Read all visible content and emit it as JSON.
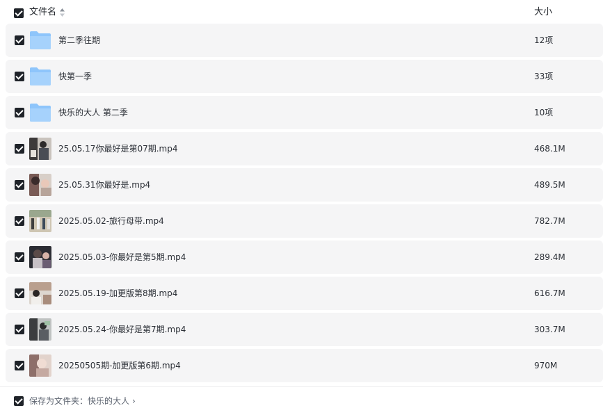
{
  "header": {
    "name_label": "文件名",
    "size_label": "大小",
    "sort_icon": "sort-icon"
  },
  "files": [
    {
      "type": "folder",
      "name": "第二季往期",
      "size": "12项"
    },
    {
      "type": "folder",
      "name": "快第一季",
      "size": "33项"
    },
    {
      "type": "folder",
      "name": "快乐的大人 第二季",
      "size": "10项"
    },
    {
      "type": "video",
      "name": "25.05.17你最好是第07期.mp4",
      "size": "468.1M"
    },
    {
      "type": "video",
      "name": "25.05.31你最好是.mp4",
      "size": "489.5M"
    },
    {
      "type": "video",
      "name": "2025.05.02-旅行母带.mp4",
      "size": "782.7M"
    },
    {
      "type": "video",
      "name": "2025.05.03-你最好是第5期.mp4",
      "size": "289.4M"
    },
    {
      "type": "video",
      "name": "2025.05.19-加更版第8期.mp4",
      "size": "616.7M"
    },
    {
      "type": "video",
      "name": "2025.05.24-你最好是第7期.mp4",
      "size": "303.7M"
    },
    {
      "type": "video",
      "name": "20250505期-加更版第6期.mp4",
      "size": "970M"
    }
  ],
  "footer": {
    "save_label": "保存为文件夹：快乐的大人",
    "chevron": "›"
  },
  "colors": {
    "checkbox": "#1f2329",
    "row_bg": "#f5f5f6",
    "folder": "#8ec5fb"
  }
}
